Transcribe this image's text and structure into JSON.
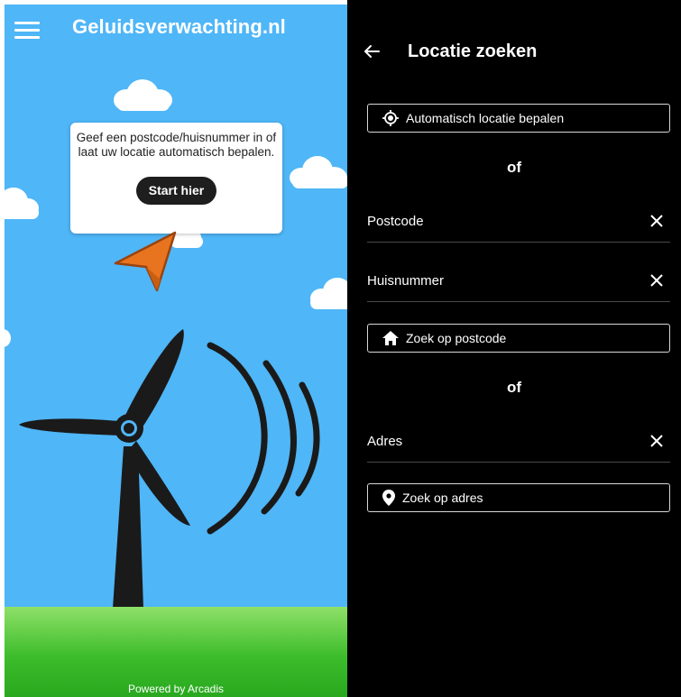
{
  "app": {
    "title": "Geluidsverwachting.nl",
    "menu_icon": "hamburger-menu-icon",
    "tooltip_text": "Geef een postcode/huisnummer in of laat uw locatie automatisch bepalen.",
    "start_button": "Start hier",
    "powered_by": "Powered by Arcadis",
    "sky_color": "#4fb6f7",
    "grass_color": "#3dbd2b",
    "arrow_color": "#e8741f"
  },
  "panel": {
    "title": "Locatie zoeken",
    "back_icon": "back-arrow-icon",
    "auto_locate_button": "Automatisch locatie bepalen",
    "or_1": "of",
    "postcode_label": "Postcode",
    "huisnummer_label": "Huisnummer",
    "search_postcode_button": "Zoek op postcode",
    "or_2": "of",
    "address_label": "Adres",
    "search_address_button": "Zoek op adres",
    "background": "#000000"
  }
}
